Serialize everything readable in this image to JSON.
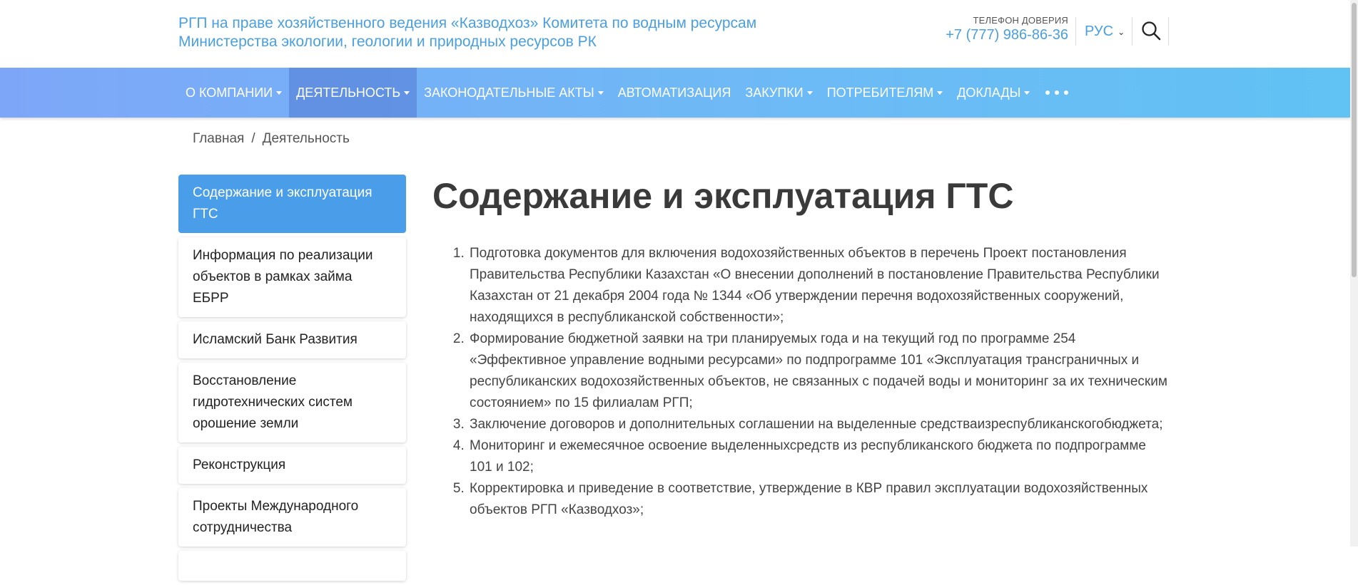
{
  "header": {
    "org_line1": "РГП на праве хозяйственного ведения «Казводхоз» Комитета по водным ресурсам",
    "org_line2": "Министерства экологии, геологии и природных ресурсов РК",
    "hotline_label": "ТЕЛЕФОН ДОВЕРИЯ",
    "hotline_phone": "+7 (777) 986-86-36",
    "language": "РУС",
    "search_icon": "search-icon"
  },
  "nav": {
    "items": [
      {
        "label": "О КОМПАНИИ",
        "dropdown": true
      },
      {
        "label": "ДЕЯТЕЛЬНОСТЬ",
        "dropdown": true,
        "active": true
      },
      {
        "label": "ЗАКОНОДАТЕЛЬНЫЕ АКТЫ",
        "dropdown": true
      },
      {
        "label": "АВТОМАТИЗАЦИЯ",
        "dropdown": false
      },
      {
        "label": "ЗАКУПКИ",
        "dropdown": true
      },
      {
        "label": "ПОТРЕБИТЕЛЯМ",
        "dropdown": true
      },
      {
        "label": "ДОКЛАДЫ",
        "dropdown": true
      }
    ],
    "more_icon": "more-dots-icon"
  },
  "breadcrumb": {
    "home": "Главная",
    "separator": "/",
    "current": "Деятельность"
  },
  "sidebar": {
    "items": [
      {
        "label": "Содержание и эксплуатация ГТС",
        "active": true
      },
      {
        "label": "Информация по реализации объектов в рамках займа ЕБРР"
      },
      {
        "label": "Исламский Банк Развития"
      },
      {
        "label": "Восстановление гидротехнических систем орошение земли"
      },
      {
        "label": "Реконструкция"
      },
      {
        "label": "Проекты Международного сотрудничества"
      }
    ]
  },
  "main": {
    "title": "Содержание и эксплуатация ГТС",
    "list": [
      "Подготовка документов для включения водохозяйственных объектов в перечень Проект постановления Правительства Республики Казахстан «О внесении дополнений в постановление Правительства Республики Казахстан от 21 декабря 2004 года № 1344 «Об утверждении перечня водохозяйственных сооружений, находящихся в республиканской собственности»;",
      "Формирование бюджетной заявки на три планируемых года и на текущий год по программе 254 «Эффективное управление водными ресурсами» по подпрограмме 101 «Эксплуатация трансграничных и республиканских водохозяйственных объектов, не связанных с подачей воды и мониторинг за их техническим состоянием» по 15 филиалам РГП;",
      "Заключение договоров и дополнительных соглашении на выделенные средстваизреспубликанскогобюджета;",
      "Мониторинг и ежемесячное освоение выделенныхсредств из республиканского бюджета по подпрограмме 101 и 102;",
      "Корректировка и приведение в соответствие, утверждение в КВР правил эксплуатации водохозяйственных объектов РГП «Казводхоз»;"
    ]
  },
  "colors": {
    "accent": "#4a9fe0",
    "sidebar_active": "#4a9de8",
    "nav_gradient_start": "#7ea6f8",
    "nav_gradient_end": "#61c2f4"
  }
}
